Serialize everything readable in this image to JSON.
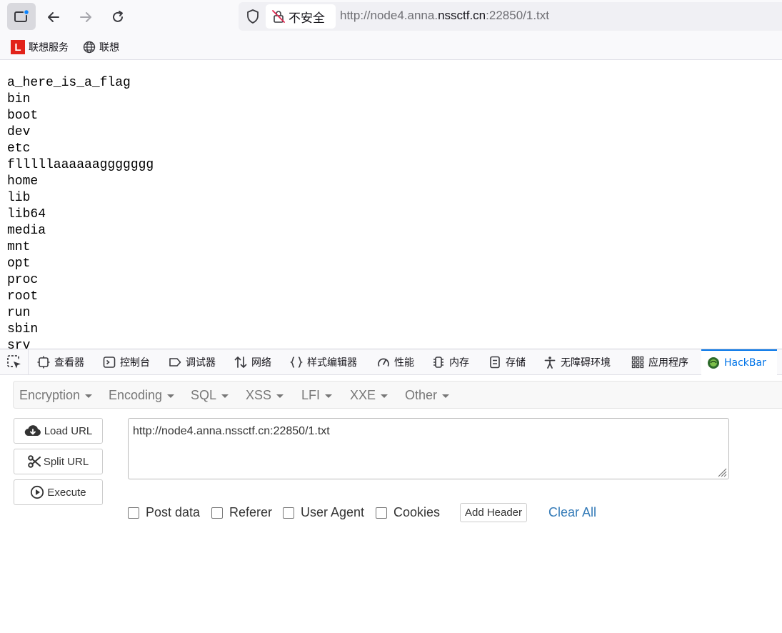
{
  "browser": {
    "security_label": "不安全",
    "url_prefix": "http://node4.anna.",
    "url_domain": "nssctf.cn",
    "url_suffix": ":22850/1.txt"
  },
  "bookmarks": [
    {
      "label": "联想服务"
    },
    {
      "label": "联想"
    }
  ],
  "listing": [
    "a_here_is_a_flag",
    "bin",
    "boot",
    "dev",
    "etc",
    "flllllaaaaaaggggggg",
    "home",
    "lib",
    "lib64",
    "media",
    "mnt",
    "opt",
    "proc",
    "root",
    "run",
    "sbin",
    "srv"
  ],
  "devtools": {
    "tabs": [
      {
        "label": "查看器",
        "icon": "inspector-icon"
      },
      {
        "label": "控制台",
        "icon": "console-icon"
      },
      {
        "label": "调试器",
        "icon": "debugger-icon"
      },
      {
        "label": "网络",
        "icon": "network-icon"
      },
      {
        "label": "样式编辑器",
        "icon": "style-editor-icon"
      },
      {
        "label": "性能",
        "icon": "performance-icon"
      },
      {
        "label": "内存",
        "icon": "memory-icon"
      },
      {
        "label": "存储",
        "icon": "storage-icon"
      },
      {
        "label": "无障碍环境",
        "icon": "accessibility-icon"
      },
      {
        "label": "应用程序",
        "icon": "application-icon"
      },
      {
        "label": "HackBar",
        "icon": "hackbar-icon"
      }
    ],
    "active_color": "#0074e8"
  },
  "hackbar": {
    "menu": [
      "Encryption",
      "Encoding",
      "SQL",
      "XSS",
      "LFI",
      "XXE",
      "Other"
    ],
    "load_url": "Load URL",
    "split_url": "Split URL",
    "execute": "Execute",
    "url_value": "http://node4.anna.nssctf.cn:22850/1.txt",
    "options": [
      "Post data",
      "Referer",
      "User Agent",
      "Cookies"
    ],
    "add_header": "Add Header",
    "clear_all": "Clear All",
    "link_color": "#337ab7"
  }
}
